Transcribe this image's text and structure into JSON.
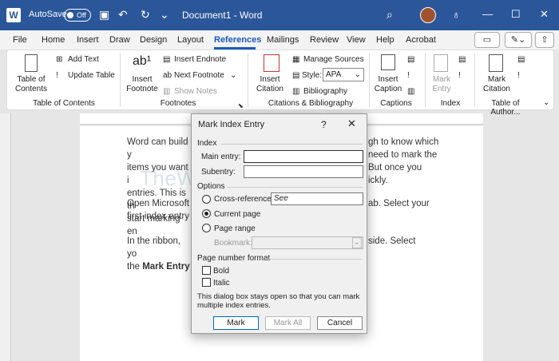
{
  "titlebar": {
    "autosave_label": "AutoSave",
    "autosave_state": "Off",
    "doc_title": "Document1 - Word"
  },
  "menu": {
    "items": [
      "File",
      "Home",
      "Insert",
      "Draw",
      "Design",
      "Layout",
      "References",
      "Mailings",
      "Review",
      "View",
      "Help",
      "Acrobat"
    ],
    "active": "References"
  },
  "ribbon": {
    "toc": {
      "big_label": "Table of Contents",
      "add_text": "Add Text",
      "update_table": "Update Table",
      "group": "Table of Contents"
    },
    "footnotes": {
      "insert_footnote": "Insert Footnote",
      "insert_endnote": "Insert Endnote",
      "next_footnote": "Next Footnote",
      "show_notes": "Show Notes",
      "group": "Footnotes"
    },
    "citations": {
      "insert_citation": "Insert Citation",
      "manage_sources": "Manage Sources",
      "style_label": "Style:",
      "style_value": "APA",
      "bibliography": "Bibliography",
      "group": "Citations & Bibliography"
    },
    "captions": {
      "insert_caption": "Insert Caption",
      "group": "Captions"
    },
    "index": {
      "mark_entry": "Mark Entry",
      "group": "Index"
    },
    "toa": {
      "mark_citation": "Mark Citation",
      "group": "Table of Author..."
    }
  },
  "document": {
    "para1": [
      "Word can build y",
      "items you want i",
      "entries. This is th",
      "start marking en"
    ],
    "para1_right": [
      "gh to know which",
      "need to mark the",
      "But once you",
      "ickly."
    ],
    "para2": [
      "Open Microsoft ",
      "first index entry"
    ],
    "para2_right": [
      "ab. Select your"
    ],
    "para3_a": "In the ribbon, yo",
    "para3_a_right": "side. Select",
    "para3_b_pre": "the ",
    "para3_b_bold": "Mark Entry",
    "watermark": "TheWindowsClub.com"
  },
  "dialog": {
    "title": "Mark Index Entry",
    "help": "?",
    "close": "✕",
    "index_section": "Index",
    "main_entry_label": "Main entry:",
    "main_entry_value": "",
    "subentry_label": "Subentry:",
    "subentry_value": "",
    "options_section": "Options",
    "cross_ref_label": "Cross-reference:",
    "cross_ref_value": "See",
    "current_page": "Current page",
    "page_range": "Page range",
    "bookmark_label": "Bookmark:",
    "format_section": "Page number format",
    "bold": "Bold",
    "italic": "Italic",
    "note": "This dialog box stays open so that you can mark multiple index entries.",
    "mark": "Mark",
    "mark_all": "Mark All",
    "cancel": "Cancel"
  }
}
